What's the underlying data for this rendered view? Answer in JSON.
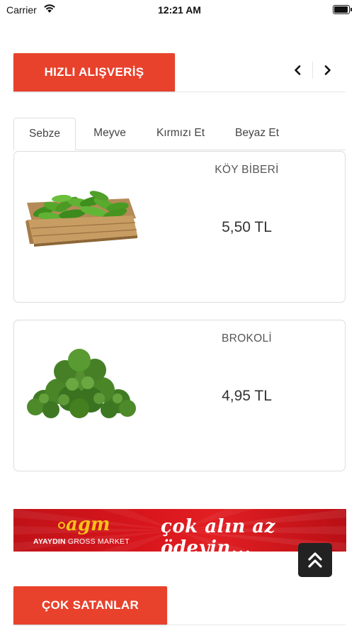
{
  "status_bar": {
    "carrier": "Carrier",
    "time": "12:21 AM"
  },
  "quick_shopping": {
    "title": "HIZLI ALIŞVERİŞ",
    "prev_icon": "chevron-left-icon",
    "next_icon": "chevron-right-icon"
  },
  "tabs": [
    {
      "label": "Sebze",
      "active": true
    },
    {
      "label": "Meyve",
      "active": false
    },
    {
      "label": "Kırmızı Et",
      "active": false
    },
    {
      "label": "Beyaz Et",
      "active": false
    }
  ],
  "products": [
    {
      "name": "KÖY BİBERİ",
      "price": "5,50 TL",
      "image": "peppers-crate"
    },
    {
      "name": "BROKOLİ",
      "price": "4,95 TL",
      "image": "broccoli"
    }
  ],
  "banner": {
    "logo_text": "agm",
    "brand": "AYAYDIN",
    "brand_rest": " GROSS MARKET",
    "slogan": "çok alın az ödeyin..."
  },
  "scroll_top_icon": "double-chevron-up-icon",
  "best_sellers": {
    "title": "ÇOK SATANLAR"
  },
  "colors": {
    "accent": "#e8412c",
    "banner_red": "#d8161c",
    "dark_button": "#222222"
  }
}
